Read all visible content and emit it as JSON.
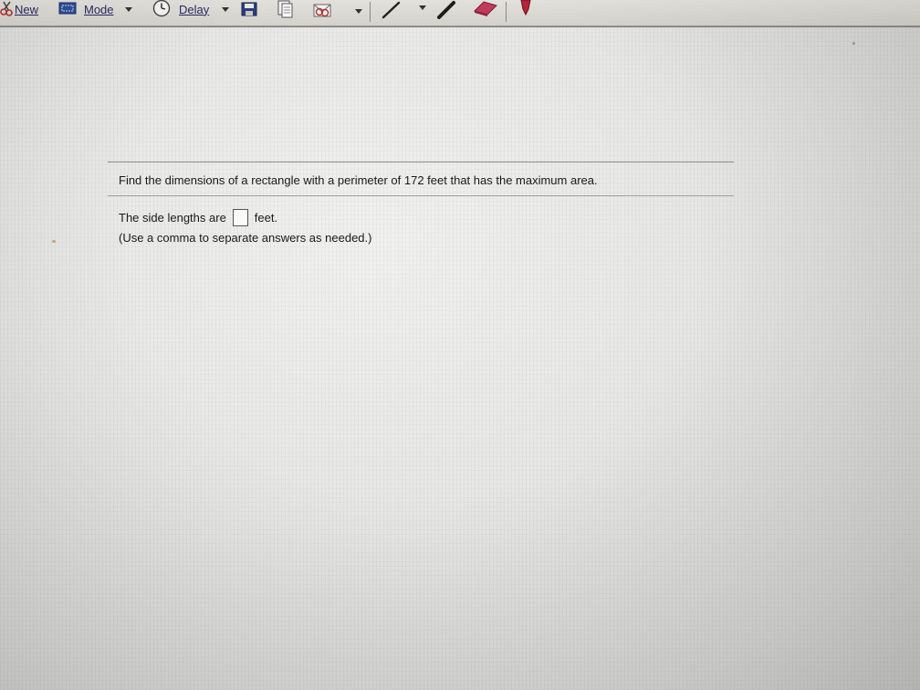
{
  "toolbar": {
    "new_label": "New",
    "mode_label": "Mode",
    "delay_label": "Delay",
    "icons": [
      "scissors-icon",
      "mode-icon",
      "clock-icon",
      "save-icon",
      "copy-icon",
      "send-icon",
      "pen-icon",
      "highlighter-icon",
      "eraser-icon",
      "pen-color-icon"
    ]
  },
  "question": {
    "prompt": "Find the dimensions of a rectangle with a perimeter of 172 feet that has the maximum area.",
    "answer_prefix": "The side lengths are",
    "answer_value": "",
    "answer_suffix": "feet.",
    "hint": "(Use a comma to separate answers as needed.)"
  },
  "colors": {
    "toolbar_bg": "#d9d8d2",
    "rule": "#8a8a88",
    "text": "#1a1a1a",
    "link_text": "#2a2a60"
  }
}
